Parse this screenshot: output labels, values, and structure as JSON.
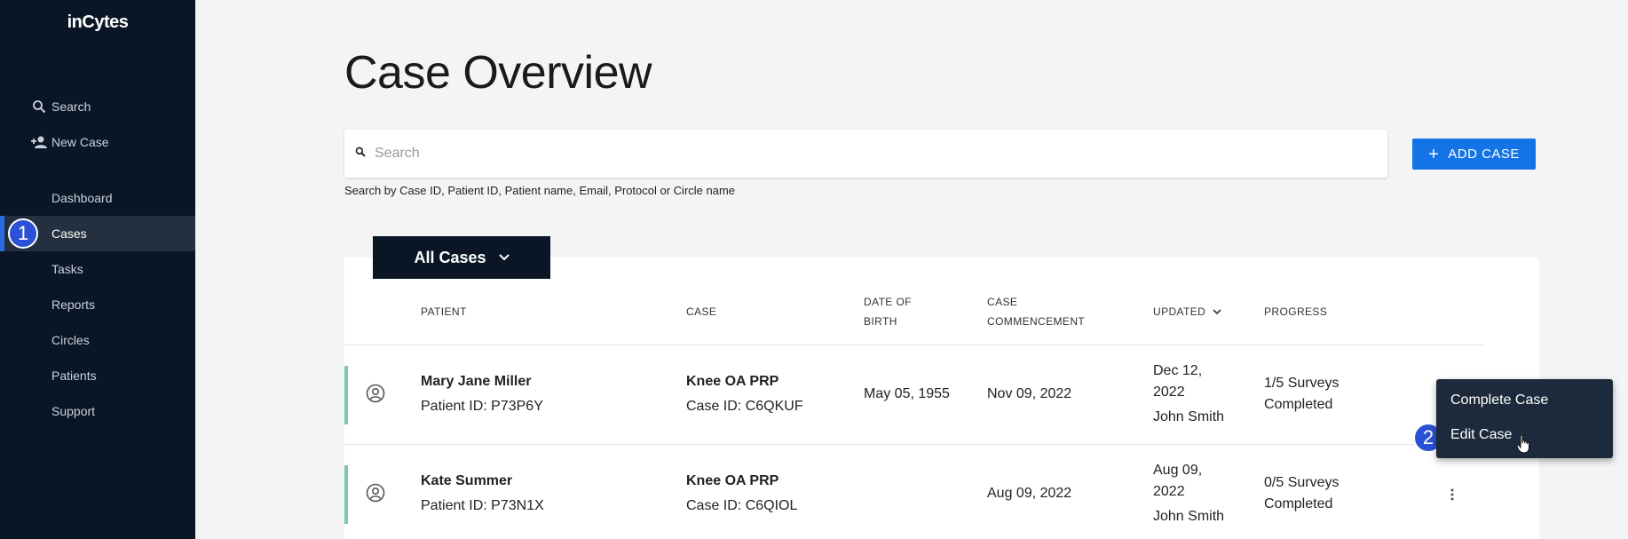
{
  "sidebar": {
    "logo": "inCytes",
    "top_items": [
      {
        "label": "Search",
        "icon": "search-icon"
      },
      {
        "label": "New Case",
        "icon": "add-person-icon"
      }
    ],
    "items": [
      {
        "label": "Dashboard"
      },
      {
        "label": "Cases",
        "active": true
      },
      {
        "label": "Tasks"
      },
      {
        "label": "Reports"
      },
      {
        "label": "Circles"
      },
      {
        "label": "Patients"
      },
      {
        "label": "Support"
      }
    ]
  },
  "badges": {
    "step1": "1",
    "step2": "2"
  },
  "main": {
    "title": "Case Overview",
    "search": {
      "placeholder": "Search",
      "hint": "Search by Case ID, Patient ID, Patient name, Email, Protocol or Circle name"
    },
    "add_button": "ADD CASE",
    "filter_tab": "All Cases"
  },
  "table": {
    "headers": {
      "patient": "PATIENT",
      "case": "CASE",
      "dob_1": "DATE OF",
      "dob_2": "BIRTH",
      "commencement_1": "CASE",
      "commencement_2": "COMMENCEMENT",
      "updated": "UPDATED",
      "progress": "PROGRESS"
    },
    "rows": [
      {
        "patient_name": "Mary Jane Miller",
        "patient_id": "Patient ID: P73P6Y",
        "case_name": "Knee OA PRP",
        "case_id": "Case ID: C6QKUF",
        "dob": "May 05, 1955",
        "commencement": "Nov 09, 2022",
        "updated_date_1": "Dec 12,",
        "updated_date_2": "2022",
        "updated_by": "John Smith",
        "progress_1": "1/5 Surveys",
        "progress_2": "Completed"
      },
      {
        "patient_name": "Kate Summer",
        "patient_id": "Patient ID: P73N1X",
        "case_name": "Knee OA PRP",
        "case_id": "Case ID: C6QIOL",
        "dob": "",
        "commencement": "Aug 09, 2022",
        "updated_date_1": "Aug 09,",
        "updated_date_2": "2022",
        "updated_by": "John Smith",
        "progress_1": "0/5 Surveys",
        "progress_2": "Completed"
      }
    ]
  },
  "context_menu": {
    "items": [
      "Complete Case",
      "Edit Case"
    ]
  },
  "colors": {
    "sidebar_bg": "#0a1626",
    "accent_blue": "#1473e6",
    "row_accent": "#7fc7a9",
    "badge": "#2b52d6"
  }
}
